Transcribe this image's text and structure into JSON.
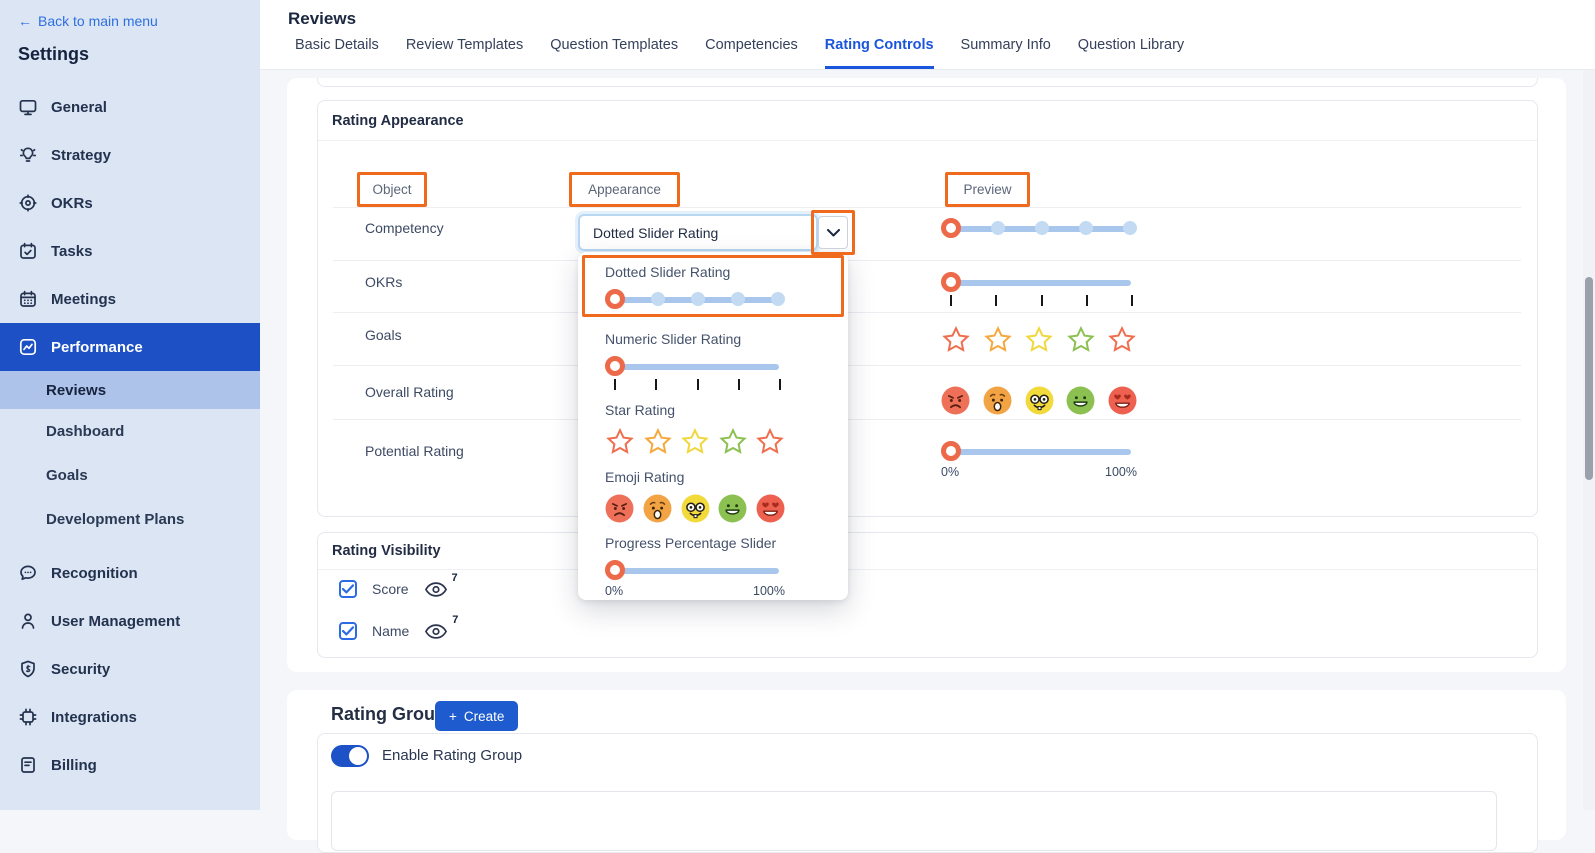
{
  "sidebar": {
    "back_link": "Back to main menu",
    "title": "Settings",
    "items": [
      {
        "label": "General",
        "icon": "monitor-icon"
      },
      {
        "label": "Strategy",
        "icon": "lightbulb-icon"
      },
      {
        "label": "OKRs",
        "icon": "target-icon"
      },
      {
        "label": "Tasks",
        "icon": "calendar-check-icon"
      },
      {
        "label": "Meetings",
        "icon": "calendar-icon"
      },
      {
        "label": "Performance",
        "icon": "performance-chart-icon",
        "active": true
      }
    ],
    "performance_sub_items": [
      {
        "label": "Reviews",
        "active": true
      },
      {
        "label": "Dashboard"
      },
      {
        "label": "Goals"
      },
      {
        "label": "Development Plans"
      }
    ],
    "items_lower": [
      {
        "label": "Recognition",
        "icon": "chat-bubble-icon"
      },
      {
        "label": "User Management",
        "icon": "user-icon"
      },
      {
        "label": "Security",
        "icon": "shield-icon"
      },
      {
        "label": "Integrations",
        "icon": "chip-icon"
      },
      {
        "label": "Billing",
        "icon": "billing-doc-icon"
      }
    ]
  },
  "header": {
    "title": "Reviews",
    "tabs": [
      {
        "label": "Basic Details"
      },
      {
        "label": "Review Templates"
      },
      {
        "label": "Question Templates"
      },
      {
        "label": "Competencies"
      },
      {
        "label": "Rating Controls",
        "active": true
      },
      {
        "label": "Summary Info"
      },
      {
        "label": "Question Library"
      }
    ]
  },
  "rating_appearance": {
    "title": "Rating Appearance",
    "columns": {
      "object": "Object",
      "appearance": "Appearance",
      "preview": "Preview"
    },
    "select": {
      "value": "Dotted Slider Rating"
    },
    "rows": [
      {
        "object": "Competency",
        "preview": "dotted-slider"
      },
      {
        "object": "OKRs",
        "preview": "numeric-slider"
      },
      {
        "object": "Goals",
        "preview": "star-rating"
      },
      {
        "object": "Overall Rating",
        "preview": "emoji-rating"
      },
      {
        "object": "Potential Rating",
        "preview": "progress-percentage-slider"
      }
    ],
    "dropdown": {
      "options": [
        {
          "label": "Dotted Slider Rating",
          "widget": "dotted-slider",
          "highlighted": true
        },
        {
          "label": "Numeric Slider Rating",
          "widget": "numeric-slider"
        },
        {
          "label": "Star Rating",
          "widget": "star-rating"
        },
        {
          "label": "Emoji Rating",
          "widget": "emoji-rating"
        },
        {
          "label": "Progress Percentage Slider",
          "widget": "progress-percentage-slider"
        }
      ]
    },
    "progress": {
      "min_label": "0%",
      "max_label": "100%"
    }
  },
  "rating_visibility": {
    "title": "Rating Visibility",
    "options": [
      {
        "label": "Score",
        "count": "7",
        "checked": true
      },
      {
        "label": "Name",
        "count": "7",
        "checked": true
      }
    ]
  },
  "rating_groups": {
    "title": "Rating Groups",
    "create_button": "Create",
    "toggle_label": "Enable Rating Group",
    "toggle_on": true
  },
  "icons": {
    "back_arrow": "←",
    "plus": "+"
  },
  "colors": {
    "accent_blue": "#1a56db",
    "sidebar_bg": "#dbe5f4",
    "sidebar_selected_bg": "#1c50c4",
    "sidebar_subselected_bg": "#aec3e9",
    "annotation_orange": "#f06a1d",
    "slider_track": "#a9c7ec",
    "slider_dot": "#c3daf3",
    "slider_handle_ring": "#ec6a4a",
    "star_colors": [
      "#ef6e4e",
      "#f5a83c",
      "#f0d73e",
      "#8cc152",
      "#ef6e4e"
    ],
    "emoji_colors": [
      "#ee7058",
      "#f2a444",
      "#f2d93c",
      "#8cc152",
      "#ee6150"
    ],
    "create_button": "#1d5bce",
    "toggle_on": "#1d51c8",
    "checkbox_blue": "#2b6be4"
  }
}
